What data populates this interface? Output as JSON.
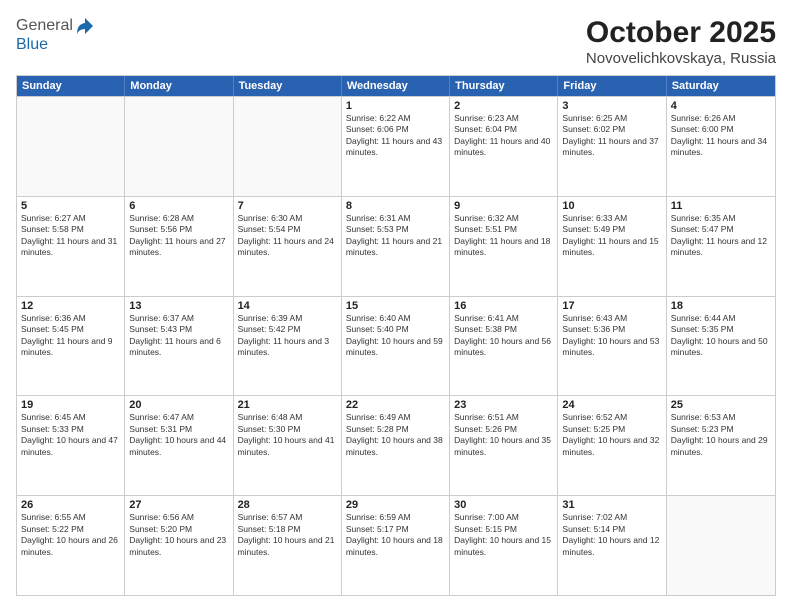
{
  "header": {
    "logo": {
      "line1": "General",
      "line2": "Blue",
      "icon": "▶"
    },
    "title": "October 2025",
    "subtitle": "Novovelichkovskaya, Russia"
  },
  "calendar": {
    "weekdays": [
      "Sunday",
      "Monday",
      "Tuesday",
      "Wednesday",
      "Thursday",
      "Friday",
      "Saturday"
    ],
    "rows": [
      [
        {
          "day": "",
          "info": ""
        },
        {
          "day": "",
          "info": ""
        },
        {
          "day": "",
          "info": ""
        },
        {
          "day": "1",
          "info": "Sunrise: 6:22 AM\nSunset: 6:06 PM\nDaylight: 11 hours and 43 minutes."
        },
        {
          "day": "2",
          "info": "Sunrise: 6:23 AM\nSunset: 6:04 PM\nDaylight: 11 hours and 40 minutes."
        },
        {
          "day": "3",
          "info": "Sunrise: 6:25 AM\nSunset: 6:02 PM\nDaylight: 11 hours and 37 minutes."
        },
        {
          "day": "4",
          "info": "Sunrise: 6:26 AM\nSunset: 6:00 PM\nDaylight: 11 hours and 34 minutes."
        }
      ],
      [
        {
          "day": "5",
          "info": "Sunrise: 6:27 AM\nSunset: 5:58 PM\nDaylight: 11 hours and 31 minutes."
        },
        {
          "day": "6",
          "info": "Sunrise: 6:28 AM\nSunset: 5:56 PM\nDaylight: 11 hours and 27 minutes."
        },
        {
          "day": "7",
          "info": "Sunrise: 6:30 AM\nSunset: 5:54 PM\nDaylight: 11 hours and 24 minutes."
        },
        {
          "day": "8",
          "info": "Sunrise: 6:31 AM\nSunset: 5:53 PM\nDaylight: 11 hours and 21 minutes."
        },
        {
          "day": "9",
          "info": "Sunrise: 6:32 AM\nSunset: 5:51 PM\nDaylight: 11 hours and 18 minutes."
        },
        {
          "day": "10",
          "info": "Sunrise: 6:33 AM\nSunset: 5:49 PM\nDaylight: 11 hours and 15 minutes."
        },
        {
          "day": "11",
          "info": "Sunrise: 6:35 AM\nSunset: 5:47 PM\nDaylight: 11 hours and 12 minutes."
        }
      ],
      [
        {
          "day": "12",
          "info": "Sunrise: 6:36 AM\nSunset: 5:45 PM\nDaylight: 11 hours and 9 minutes."
        },
        {
          "day": "13",
          "info": "Sunrise: 6:37 AM\nSunset: 5:43 PM\nDaylight: 11 hours and 6 minutes."
        },
        {
          "day": "14",
          "info": "Sunrise: 6:39 AM\nSunset: 5:42 PM\nDaylight: 11 hours and 3 minutes."
        },
        {
          "day": "15",
          "info": "Sunrise: 6:40 AM\nSunset: 5:40 PM\nDaylight: 10 hours and 59 minutes."
        },
        {
          "day": "16",
          "info": "Sunrise: 6:41 AM\nSunset: 5:38 PM\nDaylight: 10 hours and 56 minutes."
        },
        {
          "day": "17",
          "info": "Sunrise: 6:43 AM\nSunset: 5:36 PM\nDaylight: 10 hours and 53 minutes."
        },
        {
          "day": "18",
          "info": "Sunrise: 6:44 AM\nSunset: 5:35 PM\nDaylight: 10 hours and 50 minutes."
        }
      ],
      [
        {
          "day": "19",
          "info": "Sunrise: 6:45 AM\nSunset: 5:33 PM\nDaylight: 10 hours and 47 minutes."
        },
        {
          "day": "20",
          "info": "Sunrise: 6:47 AM\nSunset: 5:31 PM\nDaylight: 10 hours and 44 minutes."
        },
        {
          "day": "21",
          "info": "Sunrise: 6:48 AM\nSunset: 5:30 PM\nDaylight: 10 hours and 41 minutes."
        },
        {
          "day": "22",
          "info": "Sunrise: 6:49 AM\nSunset: 5:28 PM\nDaylight: 10 hours and 38 minutes."
        },
        {
          "day": "23",
          "info": "Sunrise: 6:51 AM\nSunset: 5:26 PM\nDaylight: 10 hours and 35 minutes."
        },
        {
          "day": "24",
          "info": "Sunrise: 6:52 AM\nSunset: 5:25 PM\nDaylight: 10 hours and 32 minutes."
        },
        {
          "day": "25",
          "info": "Sunrise: 6:53 AM\nSunset: 5:23 PM\nDaylight: 10 hours and 29 minutes."
        }
      ],
      [
        {
          "day": "26",
          "info": "Sunrise: 6:55 AM\nSunset: 5:22 PM\nDaylight: 10 hours and 26 minutes."
        },
        {
          "day": "27",
          "info": "Sunrise: 6:56 AM\nSunset: 5:20 PM\nDaylight: 10 hours and 23 minutes."
        },
        {
          "day": "28",
          "info": "Sunrise: 6:57 AM\nSunset: 5:18 PM\nDaylight: 10 hours and 21 minutes."
        },
        {
          "day": "29",
          "info": "Sunrise: 6:59 AM\nSunset: 5:17 PM\nDaylight: 10 hours and 18 minutes."
        },
        {
          "day": "30",
          "info": "Sunrise: 7:00 AM\nSunset: 5:15 PM\nDaylight: 10 hours and 15 minutes."
        },
        {
          "day": "31",
          "info": "Sunrise: 7:02 AM\nSunset: 5:14 PM\nDaylight: 10 hours and 12 minutes."
        },
        {
          "day": "",
          "info": ""
        }
      ]
    ]
  }
}
